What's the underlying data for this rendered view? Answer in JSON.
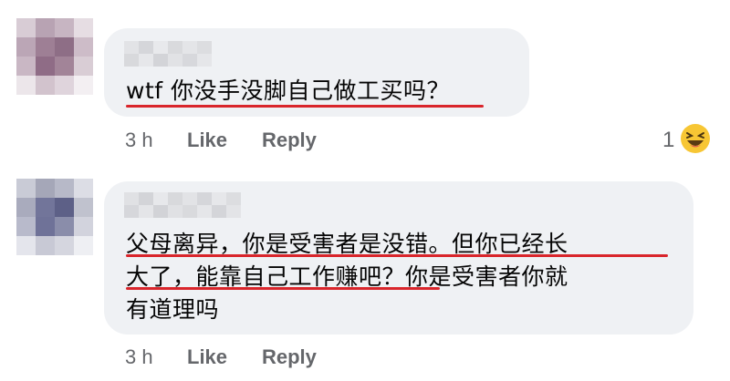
{
  "comments": [
    {
      "text": "wtf 你没手没脚自己做工买吗？",
      "time": "3 h",
      "like_label": "Like",
      "reply_label": "Reply",
      "reaction_count": "1",
      "reaction_icon": "laughing-emoji"
    },
    {
      "text": "父母离异，你是受害者是没错。但你已经长大了，能靠自己工作赚吧？你是受害者你就有道理吗",
      "line1": "父母离异，你是受害者是没错。但你已经长",
      "line2": "大了，能靠自己工作赚吧？你是受害者你就",
      "line3": "有道理吗",
      "time": "3 h",
      "like_label": "Like",
      "reply_label": "Reply"
    }
  ],
  "colors": {
    "bubble": "#eff1f4",
    "underline": "#d9252b",
    "meta_text": "#65676b",
    "body_text": "#050505"
  }
}
